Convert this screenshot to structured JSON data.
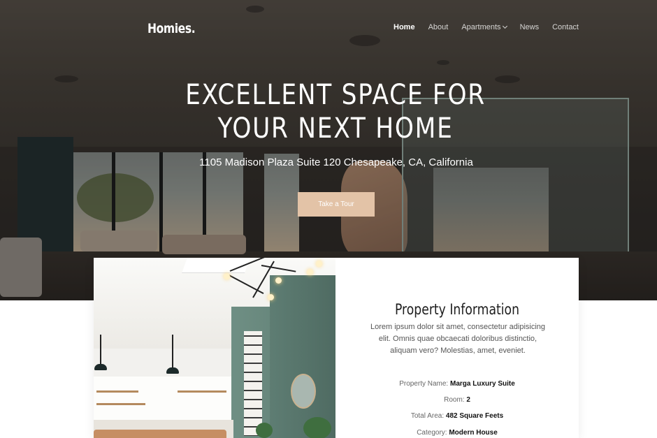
{
  "brand": {
    "logo": "Homies."
  },
  "nav": {
    "items": [
      {
        "label": "Home",
        "active": true
      },
      {
        "label": "About",
        "active": false
      },
      {
        "label": "Apartments",
        "active": false,
        "has_dropdown": true
      },
      {
        "label": "News",
        "active": false
      },
      {
        "label": "Contact",
        "active": false
      }
    ]
  },
  "hero": {
    "headline_line1": "EXCELLENT SPACE FOR",
    "headline_line2": "YOUR NEXT HOME",
    "address": "1105 Madison Plaza Suite 120 Chesapeake, CA, California",
    "cta_label": "Take a Tour"
  },
  "property": {
    "title": "Property Information",
    "description": "Lorem ipsum dolor sit amet, consectetur adipisicing elit. Omnis quae obcaecati doloribus distinctio, aliquam vero? Molestias, amet, eveniet.",
    "details": [
      {
        "label": "Property Name:",
        "value": "Marga Luxury Suite"
      },
      {
        "label": "Room:",
        "value": "2"
      },
      {
        "label": "Total Area:",
        "value": "482 Square Feets"
      },
      {
        "label": "Category:",
        "value": "Modern House"
      }
    ]
  },
  "colors": {
    "accent": "#e3c3a7",
    "text_dark": "#1e1e1e",
    "text_muted": "#555555"
  }
}
